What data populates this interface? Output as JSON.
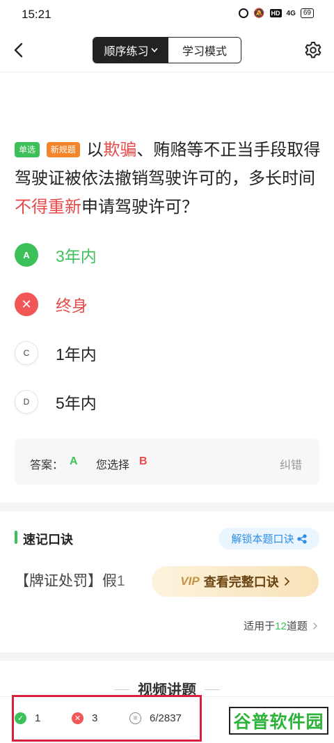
{
  "status_bar": {
    "time": "15:21",
    "hd": "HD",
    "signal": "4G",
    "battery": "69"
  },
  "nav": {
    "mode_active": "顺序练习",
    "mode_inactive": "学习模式"
  },
  "question": {
    "tag_type": "单选",
    "tag_rule": "新规题",
    "text_part1": "以",
    "highlight1": "欺骗",
    "text_part2": "、贿赂等不正当手段取得驾驶证被依法撤销驾驶许可的，多长时间",
    "highlight2": "不得重新",
    "text_part3": "申请驾驶许可？"
  },
  "options": [
    {
      "letter": "A",
      "text": "3年内",
      "state": "correct"
    },
    {
      "letter": "✕",
      "text": "终身",
      "state": "wrong"
    },
    {
      "letter": "C",
      "text": "1年内",
      "state": "plain"
    },
    {
      "letter": "D",
      "text": "5年内",
      "state": "plain"
    }
  ],
  "answer": {
    "label": "答案：",
    "value": "A",
    "choose_label": "您选择",
    "choose_value": "B",
    "report": "纠错"
  },
  "mnemonic": {
    "title": "速记口诀",
    "unlock": "解锁本题口诀",
    "preview": "【牌证处罚】假1",
    "vip_tag": "VIP",
    "vip_text": "查看完整口诀",
    "applies_prefix": "适用于",
    "applies_count": "12",
    "applies_suffix": "道题"
  },
  "video": {
    "title": "视频讲题"
  },
  "bottom_bar": {
    "correct_count": "1",
    "wrong_count": "3",
    "progress": "6/2837"
  },
  "watermark": "谷普软件园",
  "colors": {
    "green": "#3cc05a",
    "red": "#e84a4a",
    "blue": "#2d8ee8",
    "orange": "#f4852a"
  }
}
